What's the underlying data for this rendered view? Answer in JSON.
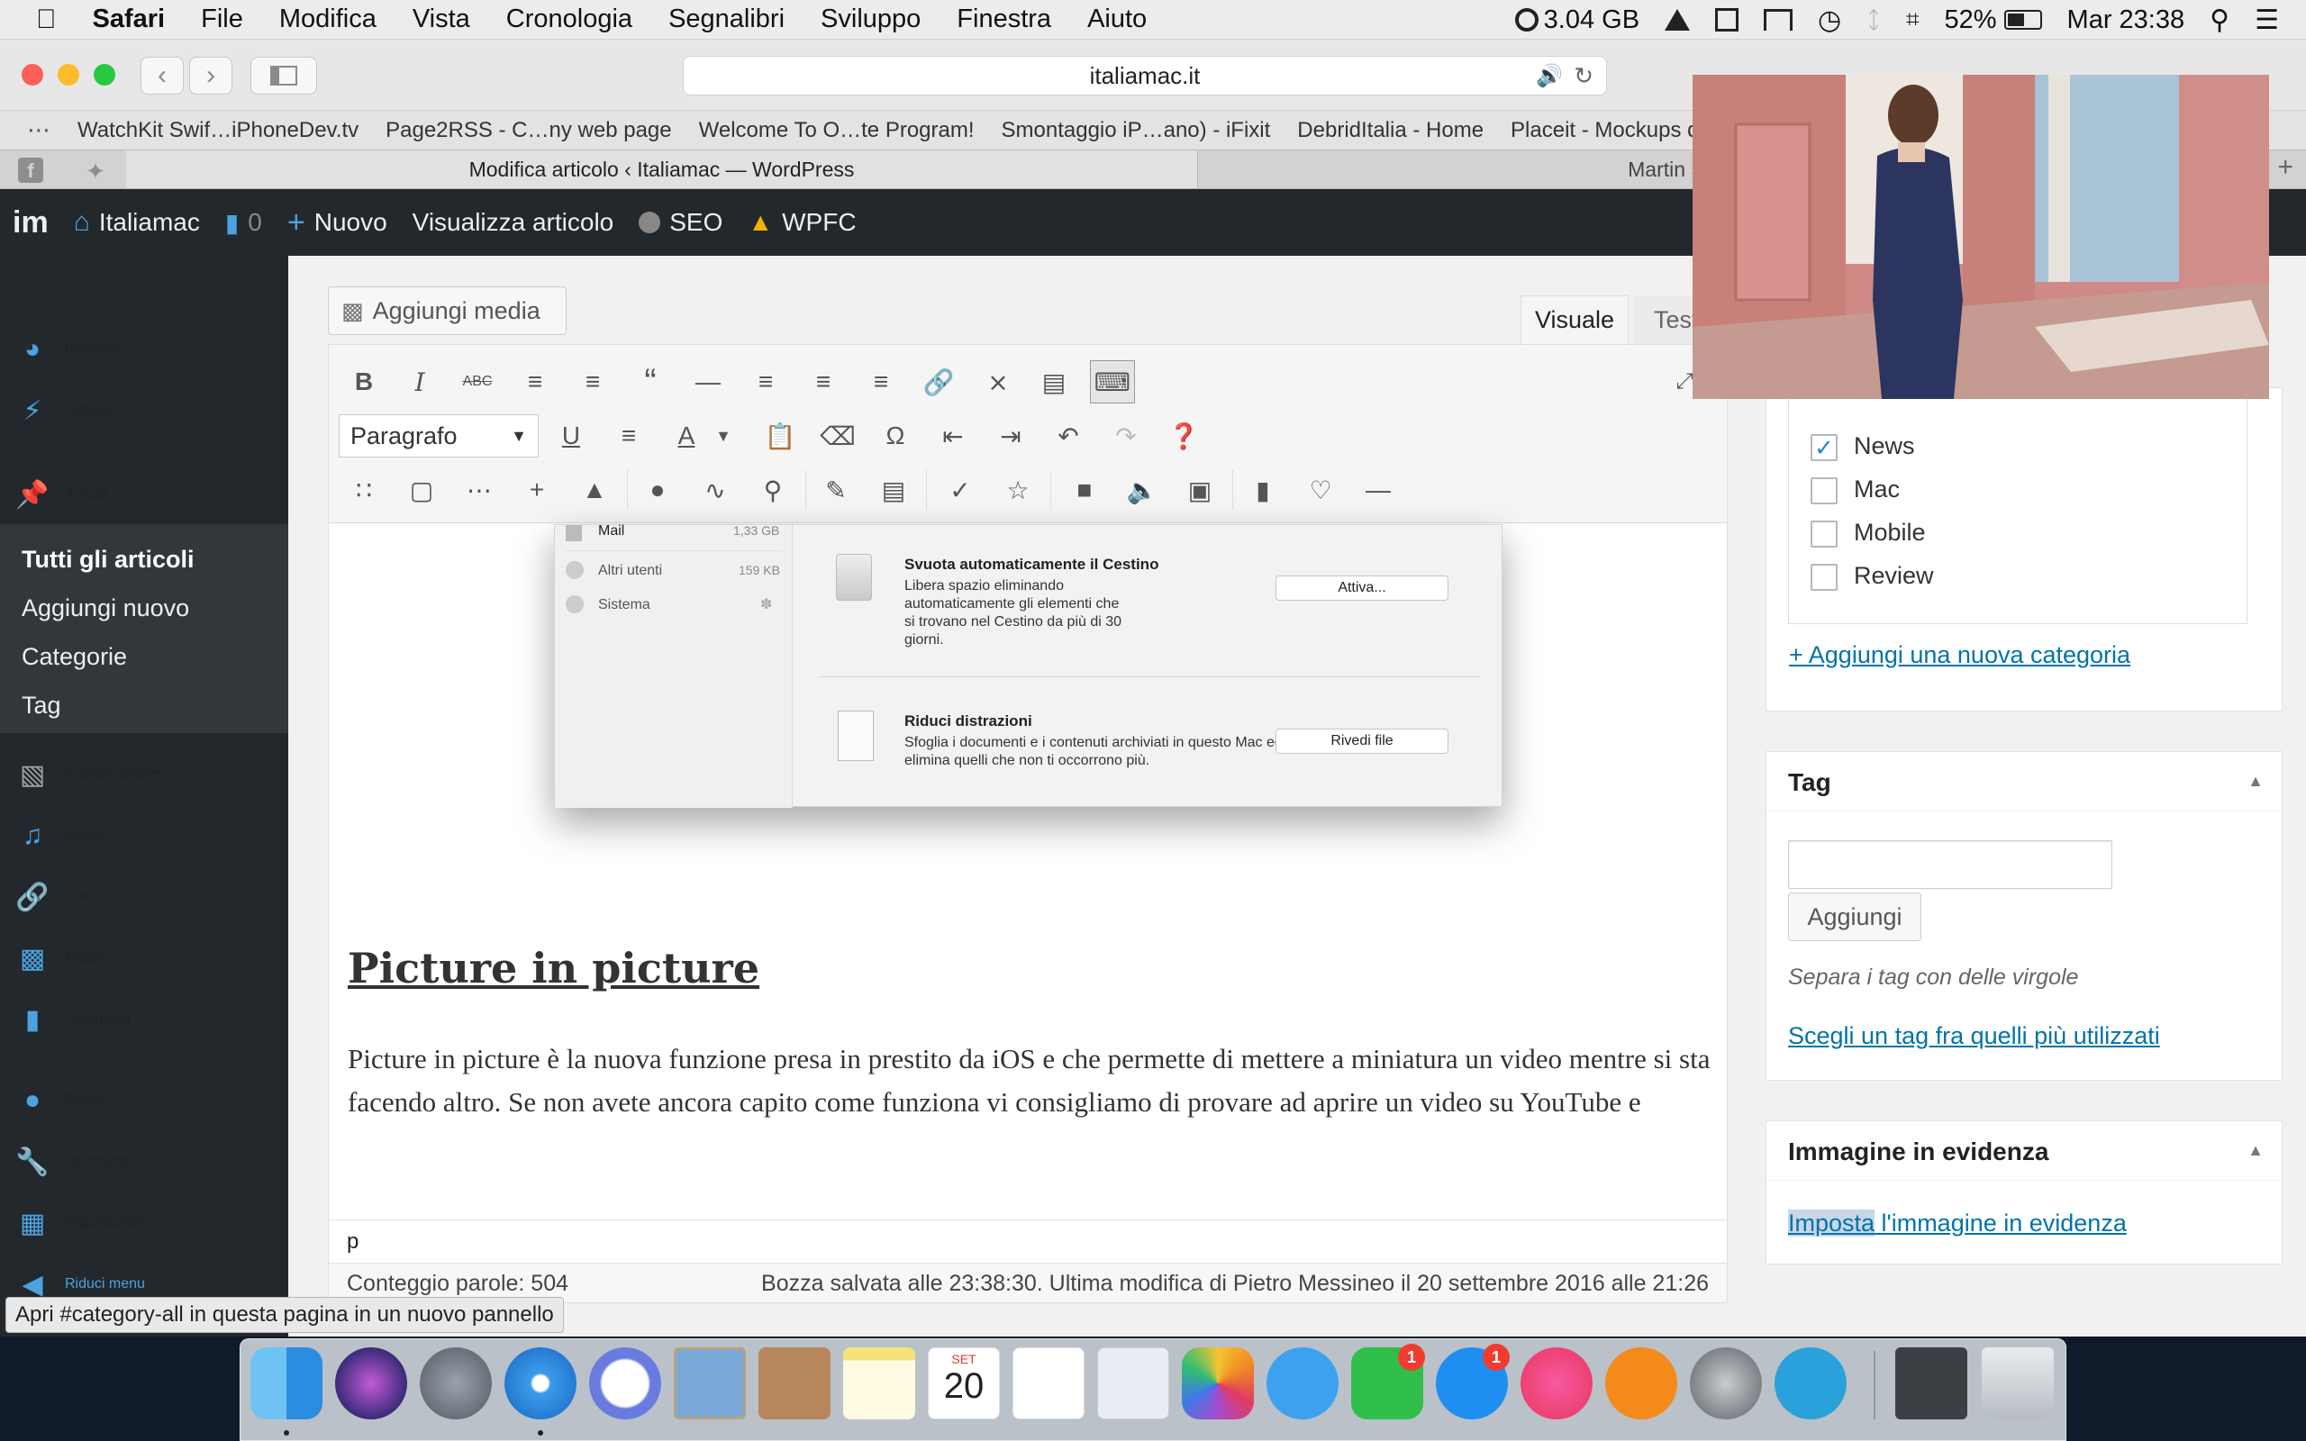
{
  "menubar": {
    "app": "Safari",
    "items": [
      "File",
      "Modifica",
      "Vista",
      "Cronologia",
      "Segnalibri",
      "Sviluppo",
      "Finestra",
      "Aiuto"
    ],
    "memory": "3.04 GB",
    "battery": "52%",
    "clock": "Mar 23:38"
  },
  "browser": {
    "url": "italiamac.it",
    "favorites": [
      "WatchKit Swif…iPhoneDev.tv",
      "Page2RSS - C…ny web page",
      "Welcome To O…te Program!",
      "Smontaggio iP…ano) - iFixit",
      "DebridItalia - Home",
      "Placeit - Mockups device"
    ],
    "tabs": [
      "Modifica articolo ‹ Italiamac — WordPress",
      "Martin Solveig - Do It R"
    ]
  },
  "adminbar": {
    "site": "Italiamac",
    "comments": "0",
    "new": "Nuovo",
    "view": "Visualizza articolo",
    "seo": "SEO",
    "wpfc": "WPFC"
  },
  "sidebar": {
    "items": [
      "Bacheca",
      "Jetpack",
      "Articoli",
      "Custom Sliders",
      "Media",
      "Link",
      "Pagine",
      "Commenti",
      "Profilo",
      "Strumenti",
      "Impostazioni",
      "Riduci menu"
    ],
    "submenu": [
      "Tutti gli articoli",
      "Aggiungi nuovo",
      "Categorie",
      "Tag"
    ]
  },
  "editor": {
    "add_media": "Aggiungi media",
    "tab_visual": "Visuale",
    "tab_text": "Testo",
    "format": "Paragrafo",
    "heading": "Picture in picture",
    "paragraph": "Picture in picture è la nuova funzione presa in prestito da iOS e che permette di mettere a miniatura un video mentre si sta facendo altro. Se non avete ancora capito come funziona vi consigliamo di provare ad aprire un video su YouTube e",
    "path": "p",
    "word_count": "Conteggio parole: 504",
    "draft_status": "Bozza salvata alle 23:38:30. Ultima modifica di Pietro Messineo il 20 settembre 2016 alle 21:26"
  },
  "screenshot": {
    "rows": [
      {
        "name": "Mail",
        "size": "1,33 GB"
      },
      {
        "name": "Altri utenti",
        "size": "159 KB"
      },
      {
        "name": "Sistema",
        "size": ""
      }
    ],
    "section1_title": "Svuota automaticamente il Cestino",
    "section1_text": "Libera spazio eliminando automaticamente gli elementi che si trovano nel Cestino da più di 30 giorni.",
    "section1_button": "Attiva...",
    "section2_title": "Riduci distrazioni",
    "section2_text": "Sfoglia i documenti e i contenuti archiviati in questo Mac ed elimina quelli che non ti occorrono più.",
    "section2_button": "Rivedi file"
  },
  "categories": {
    "items": [
      {
        "label": "News",
        "checked": true
      },
      {
        "label": "Mac",
        "checked": false
      },
      {
        "label": "Mobile",
        "checked": false
      },
      {
        "label": "Review",
        "checked": false
      }
    ],
    "add_link": "+ Aggiungi una nuova categoria"
  },
  "tags": {
    "title": "Tag",
    "input_value": "",
    "add_button": "Aggiungi",
    "hint": "Separa i tag con delle virgole",
    "popular_link": "Scegli un tag fra quelli più utilizzati"
  },
  "featured": {
    "title": "Immagine in evidenza",
    "link_selected": "Imposta",
    "link_rest": " l'immagine in evidenza"
  },
  "hover_status": "Apri #category-all in questa pagina in un nuovo pannello",
  "dock": {
    "calendar_month": "SET",
    "calendar_day": "20",
    "facetime_badge": "1",
    "appstore_badge": "1"
  },
  "colors": {
    "wp_dark": "#23282d",
    "wp_blue": "#0073aa",
    "pip_wall": "#d38b8b"
  }
}
